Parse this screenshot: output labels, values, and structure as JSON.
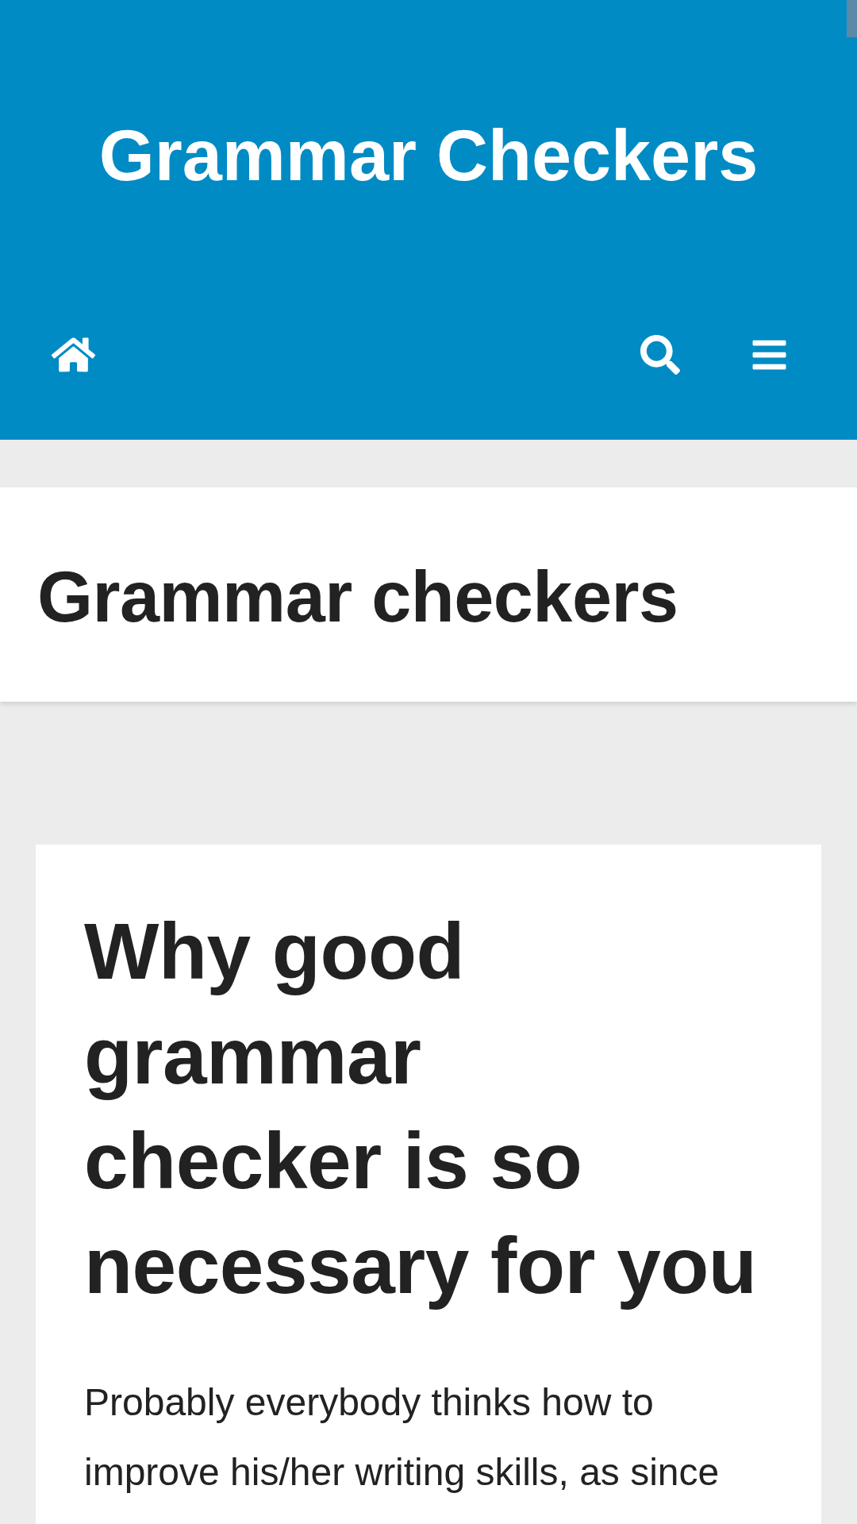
{
  "site": {
    "title": "Grammar Checkers"
  },
  "page_header": {
    "title": "Grammar checkers"
  },
  "post": {
    "title": "Why good\ngrammar\nchecker is so\nnecessary for you",
    "excerpt": "Probably everybody thinks how to improve his/her writing skills, as since"
  }
}
